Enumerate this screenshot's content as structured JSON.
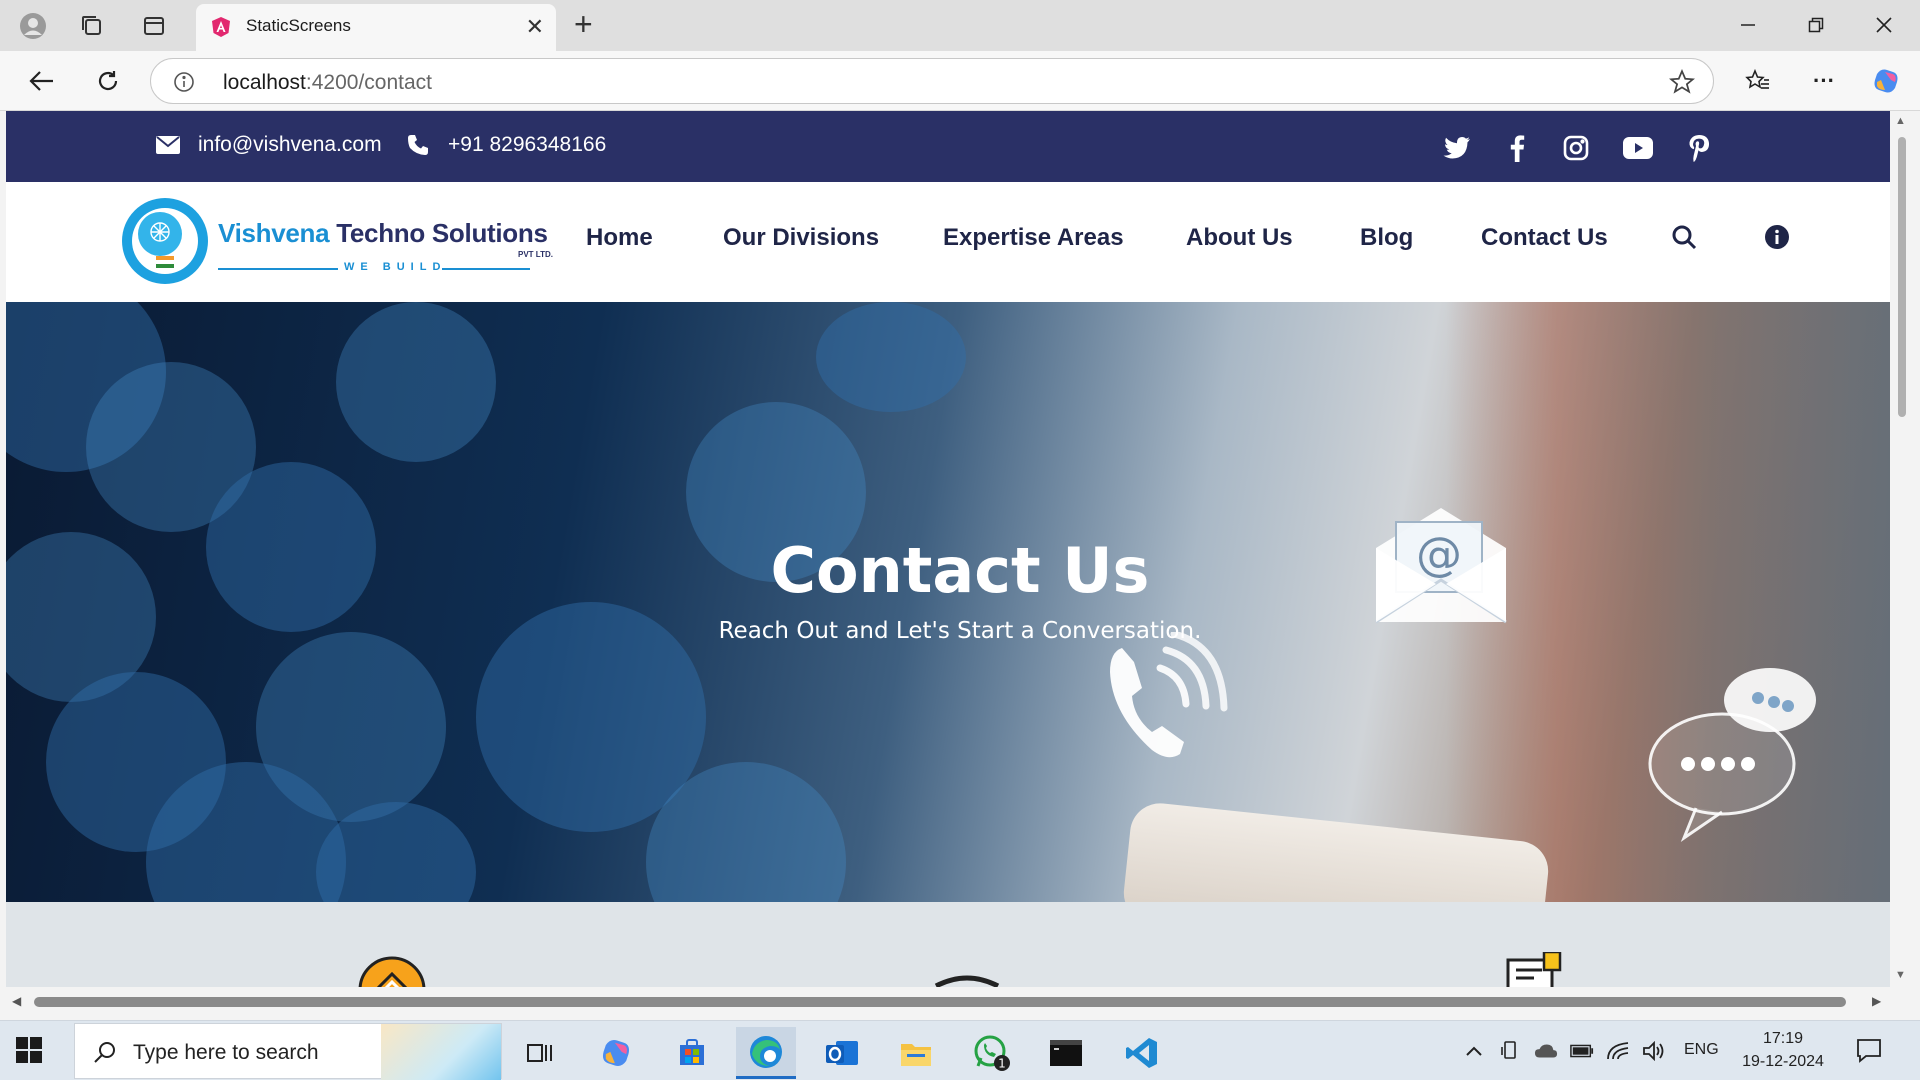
{
  "browser": {
    "tab_title": "StaticScreens",
    "url_host": "localhost",
    "url_rest": ":4200/contact"
  },
  "topbar": {
    "email": "info@vishvena.com",
    "phone": "+91 8296348166",
    "socials": [
      "twitter-icon",
      "facebook-icon",
      "instagram-icon",
      "youtube-icon",
      "pinterest-icon"
    ]
  },
  "logo": {
    "name_part1": "Vishvena",
    "name_part2": "Techno Solutions",
    "suffix": "PVT LTD.",
    "tagline": "WE BUILD"
  },
  "nav": {
    "items": [
      "Home",
      "Our Divisions",
      "Expertise Areas",
      "About Us",
      "Blog",
      "Contact Us"
    ]
  },
  "hero": {
    "title": "Contact Us",
    "subtitle": "Reach Out and Let's Start a Conversation."
  },
  "taskbar": {
    "search_placeholder": "Type here to search",
    "language": "ENG",
    "time": "17:19",
    "date": "19-12-2024",
    "whatsapp_badge": "1"
  },
  "colors": {
    "topbar_bg": "#2a3066",
    "brand_blue": "#1a8fd3",
    "nav_text": "#1f2547"
  }
}
